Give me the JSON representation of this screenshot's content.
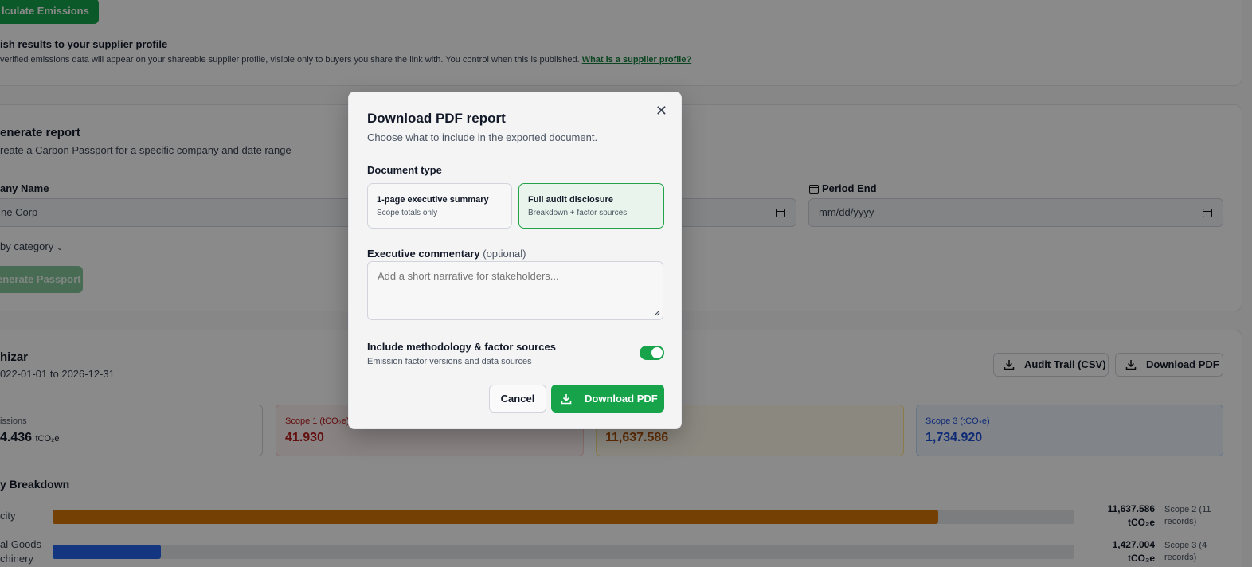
{
  "background": {
    "calculate_button": "lculate Emissions",
    "publish": {
      "title": "ish results to your supplier profile",
      "description": "verified emissions data will appear on your shareable supplier profile, visible only to buyers you share the link with. You control when this is published.",
      "link": "What is a supplier profile?"
    },
    "generate": {
      "title": "enerate report",
      "subtitle": "reate a Carbon Passport for a specific company and date range",
      "company_label": "any Name",
      "company_placeholder": "ne Corp",
      "period_end_label": "Period End",
      "date_placeholder": "mm/dd/yyyy",
      "by_category": "by category",
      "button": "enerate Passport"
    },
    "results": {
      "title": "hizar",
      "range": "022-01-01 to 2026-12-31",
      "audit_button": "Audit Trail (CSV)",
      "download_button": "Download PDF",
      "stats": [
        {
          "label": "issions",
          "value": "4.436",
          "unit": "tCO₂e",
          "color": "#111827"
        },
        {
          "label": "Scope 1 (tCO₂e)",
          "value": "41.930",
          "color": "#b91c1c"
        },
        {
          "label": "",
          "value": "11,637.586",
          "color": "#b45309"
        },
        {
          "label": "Scope 3 (tCO₂e)",
          "value": "1,734.920",
          "color": "#1d4ed8"
        }
      ],
      "breakdown_title": "y Breakdown",
      "bars": [
        {
          "label": "city",
          "fraction": 0.867,
          "color": "#d97706",
          "value": "11,637.586",
          "unit": "tCO₂e",
          "scope": "Scope 2 (11 records)"
        },
        {
          "label_1": "al Goods",
          "label_2": "chinery",
          "fraction": 0.106,
          "color": "#2563eb",
          "value": "1,427.004",
          "unit": "tCO₂e",
          "scope": "Scope 3 (4 records)"
        }
      ]
    }
  },
  "modal": {
    "title": "Download PDF report",
    "subtitle": "Choose what to include in the exported document.",
    "close_icon": "close-icon",
    "document_type_label": "Document type",
    "options": [
      {
        "title": "1-page executive summary",
        "subtitle": "Scope totals only",
        "selected": false
      },
      {
        "title": "Full audit disclosure",
        "subtitle": "Breakdown + factor sources",
        "selected": true
      }
    ],
    "commentary_label": "Executive commentary",
    "commentary_optional": "(optional)",
    "commentary_placeholder": "Add a short narrative for stakeholders...",
    "toggle_title": "Include methodology & factor sources",
    "toggle_subtitle": "Emission factor versions and data sources",
    "toggle_on": true,
    "cancel": "Cancel",
    "download": "Download PDF",
    "accent": "#16a34a"
  }
}
